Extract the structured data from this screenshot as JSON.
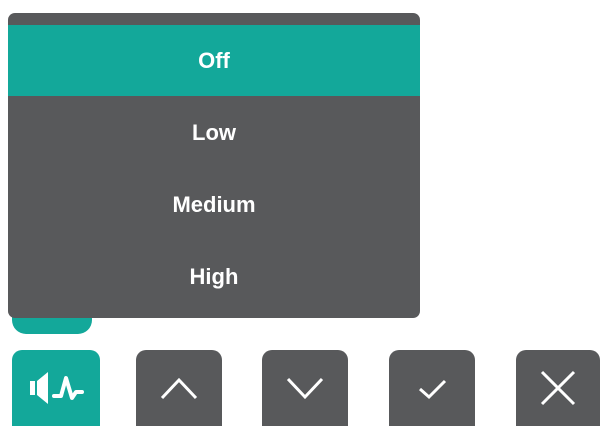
{
  "colors": {
    "accent": "#13a89a",
    "menu_bg": "#58595b",
    "button_bg": "#58595b",
    "text": "#ffffff"
  },
  "menu": {
    "selected_index": 0,
    "items": [
      {
        "label": "Off"
      },
      {
        "label": "Low"
      },
      {
        "label": "Medium"
      },
      {
        "label": "High"
      }
    ]
  },
  "buttons": [
    {
      "icon": "volume-wave-icon",
      "active": true
    },
    {
      "icon": "chevron-up-icon",
      "active": false
    },
    {
      "icon": "chevron-down-icon",
      "active": false
    },
    {
      "icon": "check-icon",
      "active": false
    },
    {
      "icon": "close-icon",
      "active": false
    }
  ]
}
